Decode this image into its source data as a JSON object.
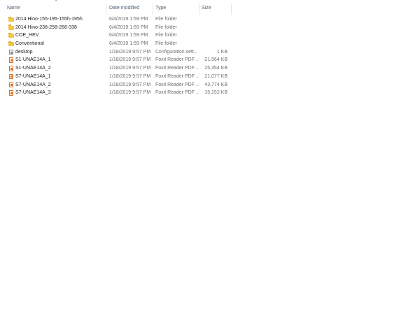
{
  "columns": {
    "name": "Name",
    "date_modified": "Date modified",
    "type": "Type",
    "size": "Size"
  },
  "sort": {
    "column": "name",
    "direction": "ascending",
    "indicator_icon": "sort-up-arrow"
  },
  "files": [
    {
      "name": "2014 Hino-155-195-155h-195h",
      "date": "6/4/2019 1:59 PM",
      "type": "File folder",
      "size": "",
      "icon": "folder-icon"
    },
    {
      "name": "2014 Hino-238-258-268-338",
      "date": "6/4/2019 1:59 PM",
      "type": "File folder",
      "size": "",
      "icon": "folder-icon"
    },
    {
      "name": "COE_HEV",
      "date": "6/4/2019 1:59 PM",
      "type": "File folder",
      "size": "",
      "icon": "folder-icon"
    },
    {
      "name": "Conventional",
      "date": "6/4/2019 1:59 PM",
      "type": "File folder",
      "size": "",
      "icon": "folder-icon"
    },
    {
      "name": "desktop",
      "date": "1/18/2019 9:57 PM",
      "type": "Configuration sett...",
      "size": "1 KB",
      "icon": "config-file-icon"
    },
    {
      "name": "S1-UNAE14A_1",
      "date": "1/18/2019 9:57 PM",
      "type": "Foxit Reader PDF ...",
      "size": "21,564 KB",
      "icon": "pdf-file-icon"
    },
    {
      "name": "S1-UNAE14A_2",
      "date": "1/18/2019 9:57 PM",
      "type": "Foxit Reader PDF ...",
      "size": "25,354 KB",
      "icon": "pdf-file-icon"
    },
    {
      "name": "S7-UNAE14A_1",
      "date": "1/18/2019 9:57 PM",
      "type": "Foxit Reader PDF ...",
      "size": "21,077 KB",
      "icon": "pdf-file-icon"
    },
    {
      "name": "S7-UNAE14A_2",
      "date": "1/18/2019 9:57 PM",
      "type": "Foxit Reader PDF ...",
      "size": "43,774 KB",
      "icon": "pdf-file-icon"
    },
    {
      "name": "S7-UNAE14A_3",
      "date": "1/18/2019 9:57 PM",
      "type": "Foxit Reader PDF ...",
      "size": "15,152 KB",
      "icon": "pdf-file-icon"
    }
  ]
}
